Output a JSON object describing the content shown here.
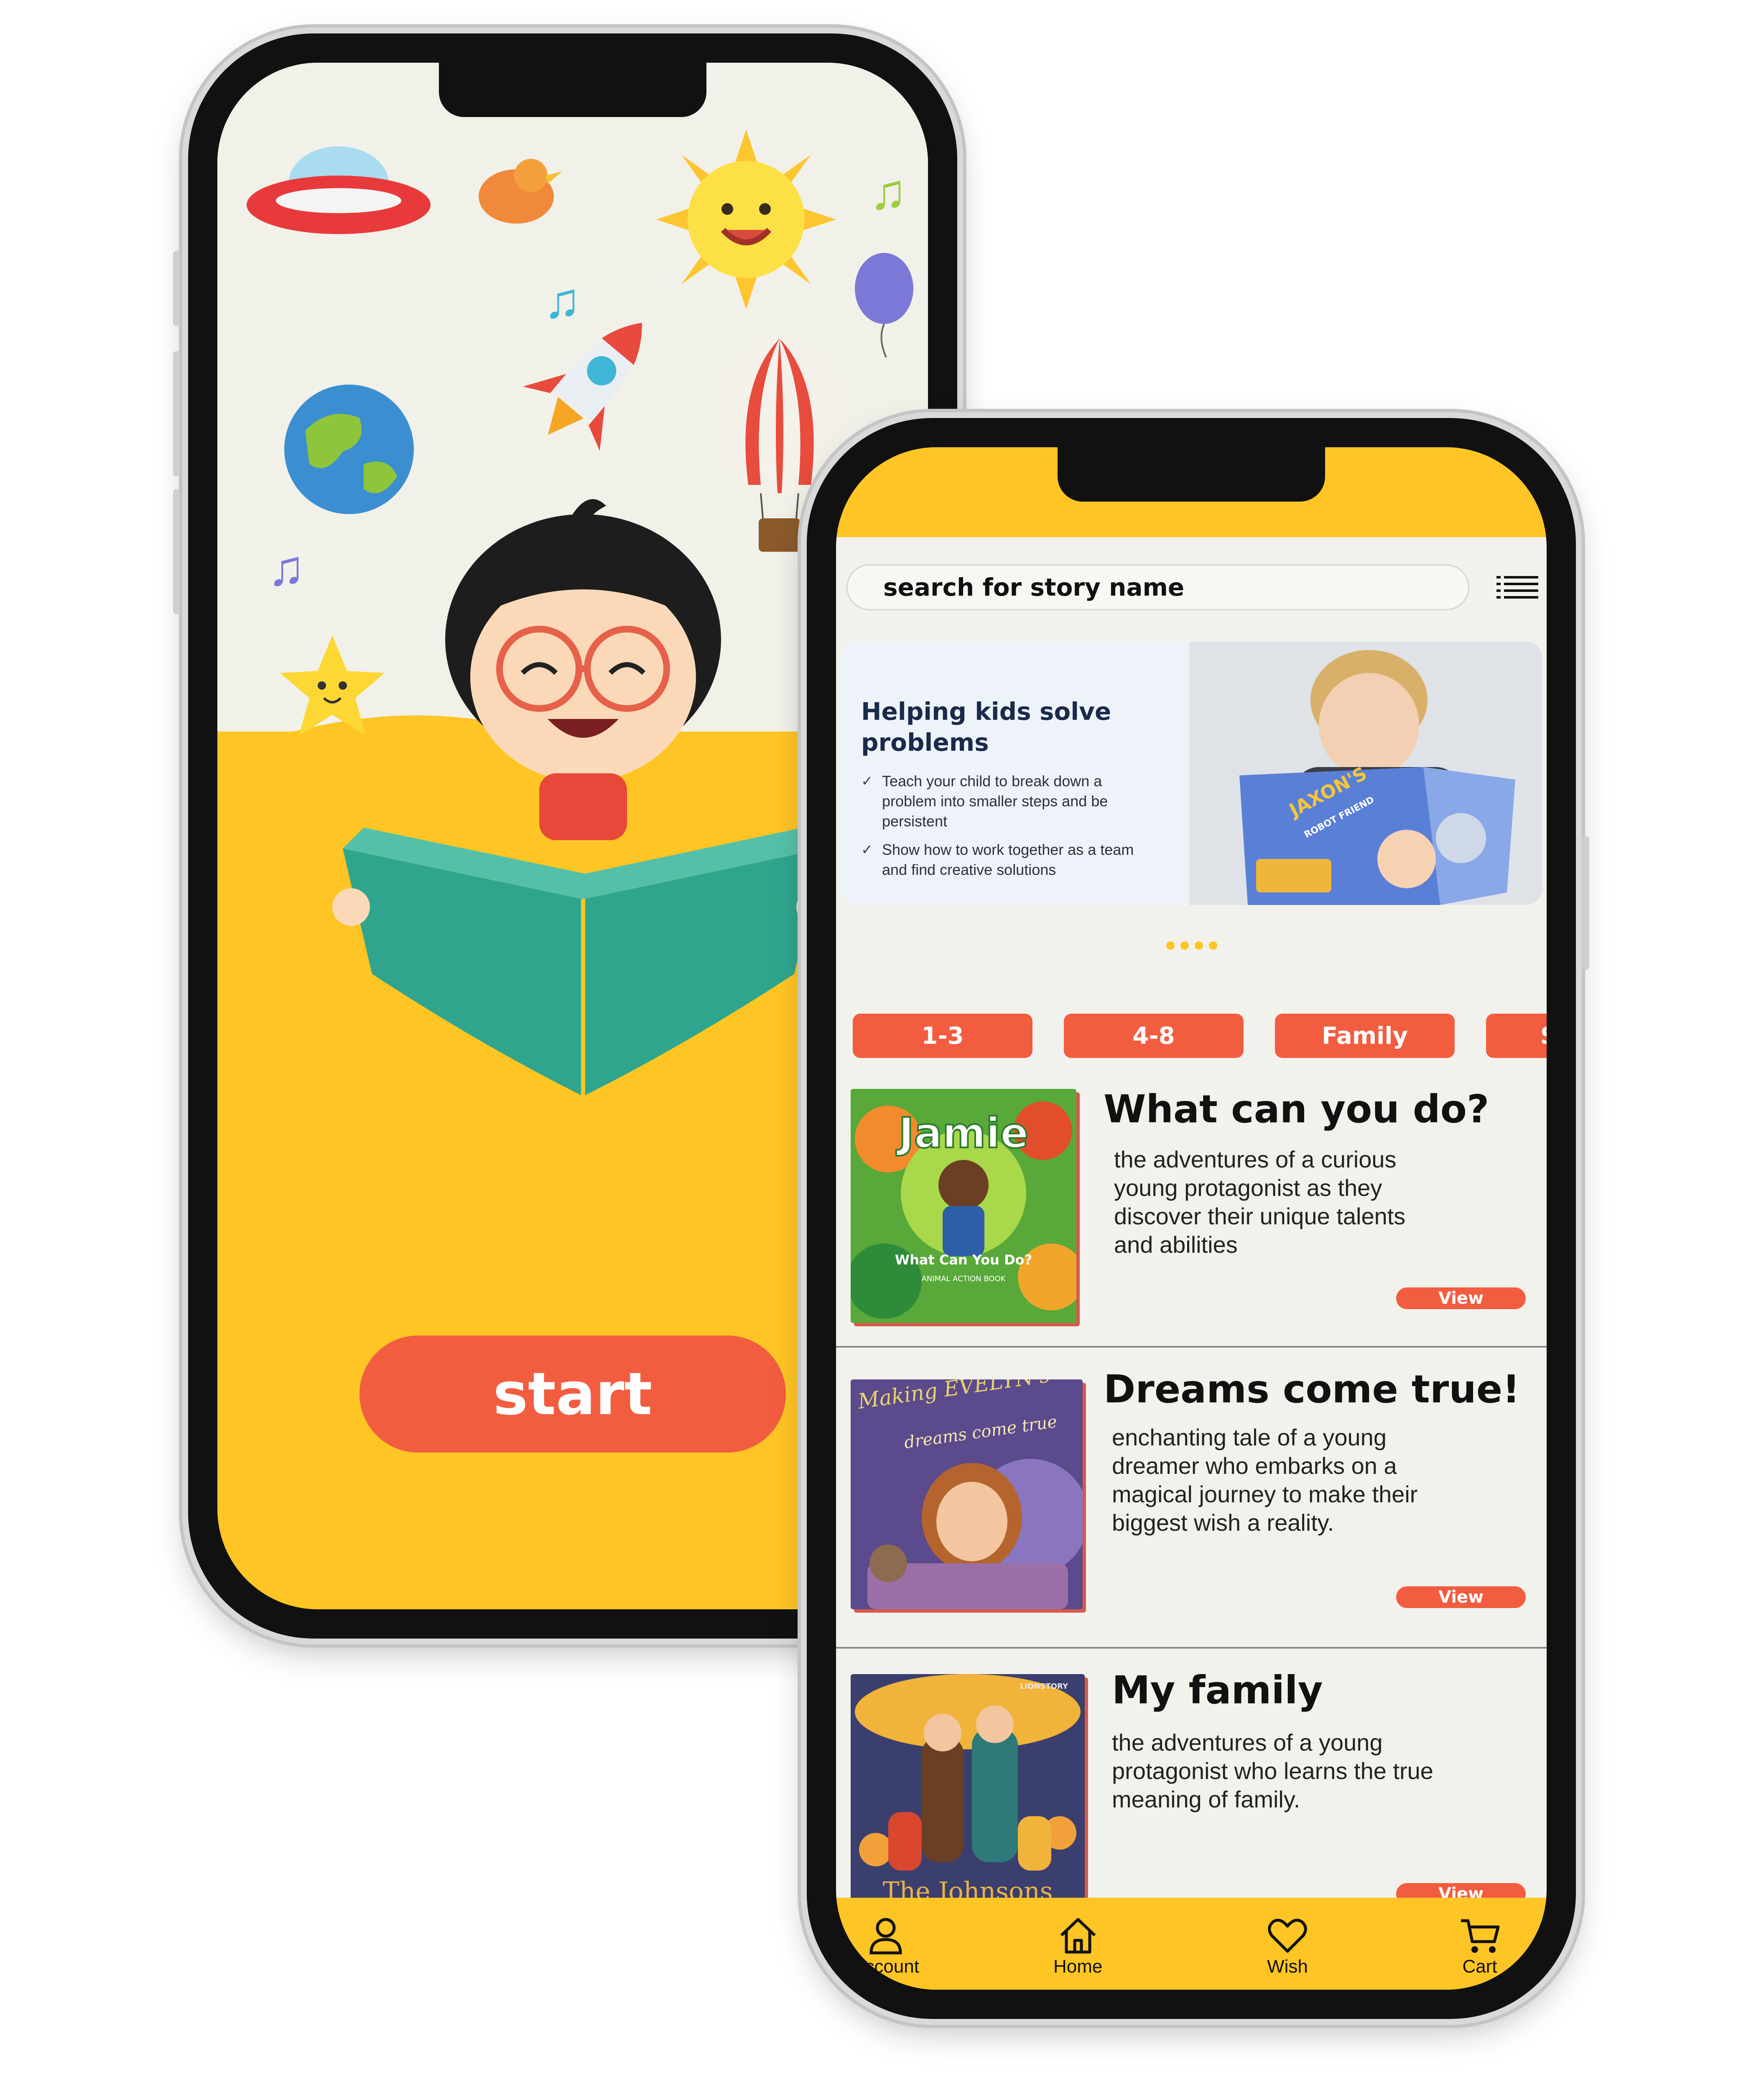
{
  "start_screen": {
    "start_label": "start"
  },
  "home_screen": {
    "search_placeholder": "search for story name",
    "banner": {
      "title": "Helping kids solve problems",
      "points": [
        "Teach your child to break down a problem into smaller steps and be persistent",
        "Show how to work together as a team and find creative solutions"
      ],
      "book_title": "JAXON'S",
      "book_subtitle": "ROBOT FRIEND"
    },
    "categories": [
      "1-3",
      "4-8",
      "Family",
      "S"
    ],
    "stories": [
      {
        "title": "What can you do?",
        "description": "the adventures of a curious young protagonist as they discover their unique talents and abilities",
        "view_label": "View",
        "cover_title": "Jamie",
        "cover_subtitle": "What Can You Do?",
        "cover_caption": "ANIMAL ACTION BOOK",
        "cover_color": "#58a83a"
      },
      {
        "title": "Dreams come true!",
        "description": "enchanting tale of a young dreamer who embarks on a magical journey to make their biggest wish a reality.",
        "view_label": "View",
        "cover_title": "Making EVELYN's",
        "cover_subtitle": "dreams come true",
        "cover_color": "#5b4a8c"
      },
      {
        "title": "My family",
        "description": "the adventures of a young protagonist who learns the true meaning of family.",
        "view_label": "View",
        "cover_title": "The Johnsons",
        "cover_caption": "LIONSTORY",
        "cover_color": "#3a3f6e"
      }
    ],
    "nav": [
      {
        "label": "Account",
        "icon": "user-icon"
      },
      {
        "label": "Home",
        "icon": "home-icon"
      },
      {
        "label": "Wish",
        "icon": "heart-icon"
      },
      {
        "label": "Cart",
        "icon": "cart-icon"
      }
    ]
  },
  "colors": {
    "yellow": "#fec524",
    "accent": "#f25d40",
    "background": "#f2f2ec"
  }
}
